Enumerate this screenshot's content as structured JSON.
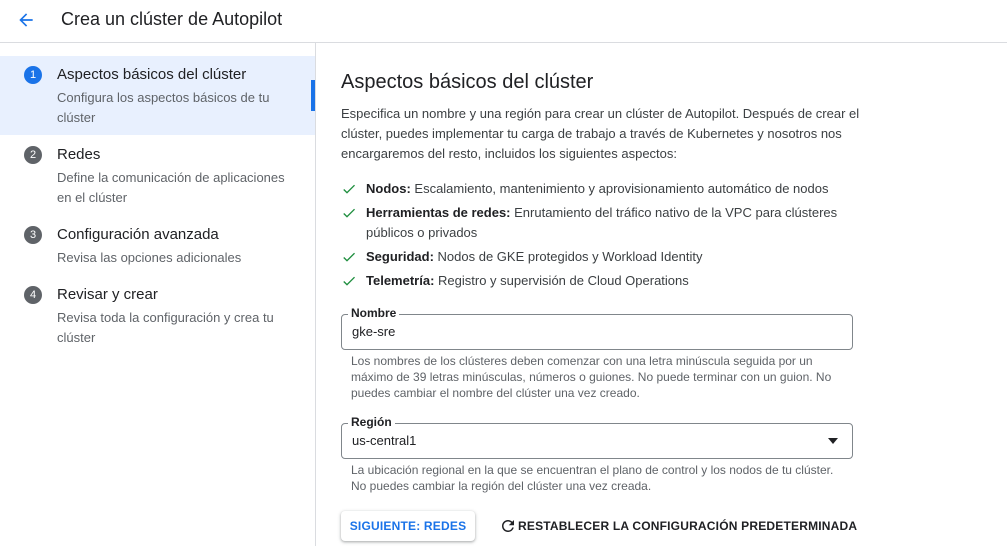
{
  "header": {
    "back_icon": "arrow-back-icon",
    "title": "Crea un clúster de Autopilot"
  },
  "colors": {
    "accent": "#1a73e8",
    "check": "#1e8e3e",
    "active_step_bg": "#e8f0fe"
  },
  "steps": [
    {
      "number": "1",
      "title": "Aspectos básicos del clúster",
      "description": "Configura los aspectos básicos de tu clúster",
      "active": true
    },
    {
      "number": "2",
      "title": "Redes",
      "description": "Define la comunicación de aplicaciones en el clúster",
      "active": false
    },
    {
      "number": "3",
      "title": "Configuración avanzada",
      "description": "Revisa las opciones adicionales",
      "active": false
    },
    {
      "number": "4",
      "title": "Revisar y crear",
      "description": "Revisa toda la configuración y crea tu clúster",
      "active": false
    }
  ],
  "main": {
    "title": "Aspectos básicos del clúster",
    "intro": "Especifica un nombre y una región para crear un clúster de Autopilot. Después de crear el clúster, puedes implementar tu carga de trabajo a través de Kubernetes y nosotros nos encargaremos del resto, incluidos los siguientes aspectos:",
    "features": [
      {
        "icon": "check-icon",
        "label": "Nodos:",
        "text": " Escalamiento, mantenimiento y aprovisionamiento automático de nodos"
      },
      {
        "icon": "check-icon",
        "label": "Herramientas de redes:",
        "text": " Enrutamiento del tráfico nativo de la VPC para clústeres públicos o privados"
      },
      {
        "icon": "check-icon",
        "label": "Seguridad:",
        "text": " Nodos de GKE protegidos y Workload Identity"
      },
      {
        "icon": "check-icon",
        "label": "Telemetría:",
        "text": " Registro y supervisión de Cloud Operations"
      }
    ],
    "name_field": {
      "label": "Nombre",
      "value": "gke-sre",
      "hint": "Los nombres de los clústeres deben comenzar con una letra minúscula seguida por un máximo de 39 letras minúsculas, números o guiones. No puede terminar con un guion. No puedes cambiar el nombre del clúster una vez creado."
    },
    "region_field": {
      "label": "Región",
      "value": "us-central1",
      "icon": "dropdown-arrow-icon",
      "hint": "La ubicación regional en la que se encuentran el plano de control y los nodos de tu clúster. No puedes cambiar la región del clúster una vez creada."
    },
    "next_button": "SIGUIENTE: REDES",
    "reset_button": "RESTABLECER LA CONFIGURACIÓN PREDETERMINADA",
    "reset_icon": "refresh-icon"
  }
}
